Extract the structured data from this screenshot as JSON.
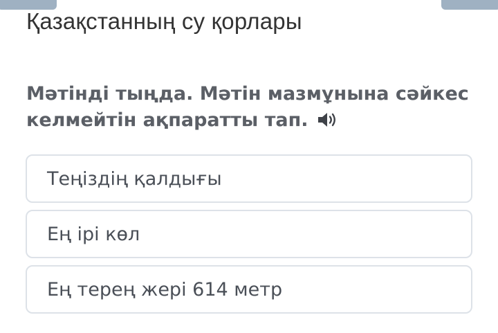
{
  "header": {
    "title": "Қазақстанның су қорлары"
  },
  "question": {
    "line1": "Мәтінді тыңда. Мәтін мазмұнына сәйкес",
    "line2": "келмейтін ақпаратты тап.",
    "audio_icon": "speaker-icon"
  },
  "options": [
    {
      "label": "Теңіздің қалдығы"
    },
    {
      "label": "Ең ірі көл"
    },
    {
      "label": "Ең терең жері 614 метр"
    }
  ],
  "colors": {
    "title": "#333333",
    "question": "#5b5f66",
    "option_text": "#4a4f57",
    "option_border": "#dde2e8",
    "top_tabs": "#9fb1c2"
  }
}
